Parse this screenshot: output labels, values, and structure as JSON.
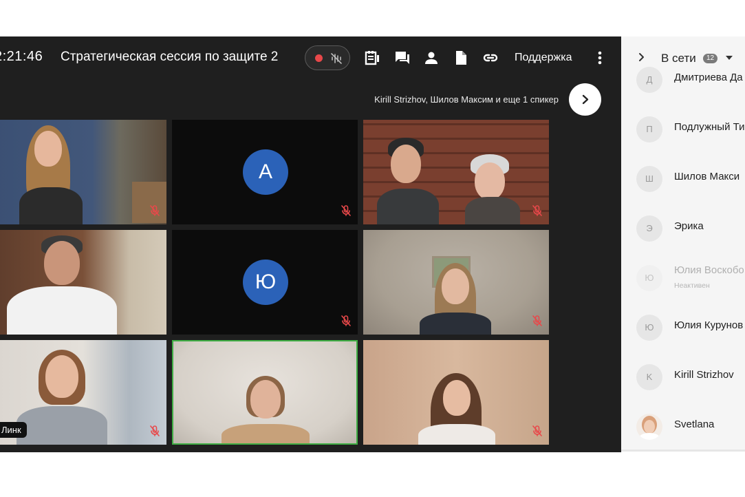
{
  "meeting": {
    "clock": "2:21:46",
    "title": "Стратегическая сессия по защите 2",
    "support_label": "Поддержка",
    "speakers_text": "Kirill Strizhov, Шилов Максим и еще 1 спикер",
    "record_color": "#e8484a",
    "active_speaker_border": "#3fae44"
  },
  "toolbar_icons": [
    "record-indicator-icon",
    "mic-muted-waves-icon",
    "notes-icon",
    "chat-icon",
    "participants-icon",
    "document-icon",
    "link-icon",
    "more-vertical-icon"
  ],
  "tiles": [
    {
      "type": "video",
      "muted": true
    },
    {
      "type": "avatar",
      "letter": "А",
      "muted": true
    },
    {
      "type": "video",
      "muted": true
    },
    {
      "type": "video",
      "muted": false
    },
    {
      "type": "avatar",
      "letter": "Ю",
      "muted": true
    },
    {
      "type": "video",
      "muted": true
    },
    {
      "type": "video",
      "label": "Линк",
      "muted": true
    },
    {
      "type": "video",
      "active": true,
      "muted": false
    },
    {
      "type": "video",
      "muted": true
    }
  ],
  "sidebar": {
    "title": "В сети",
    "count": "12",
    "participants": [
      {
        "initial": "Д",
        "name": "Дмитриева Да"
      },
      {
        "initial": "П",
        "name": "Подлужный Ти"
      },
      {
        "initial": "Ш",
        "name": "Шилов Макси"
      },
      {
        "initial": "Э",
        "name": "Эрика"
      },
      {
        "initial": "Ю",
        "name": "Юлия Воскобо",
        "status": "Неактивен"
      },
      {
        "initial": "Ю",
        "name": "Юлия Курунов"
      },
      {
        "initial": "K",
        "name": "Kirill Strizhov"
      },
      {
        "initial": "",
        "name": "Svetlana"
      }
    ]
  }
}
